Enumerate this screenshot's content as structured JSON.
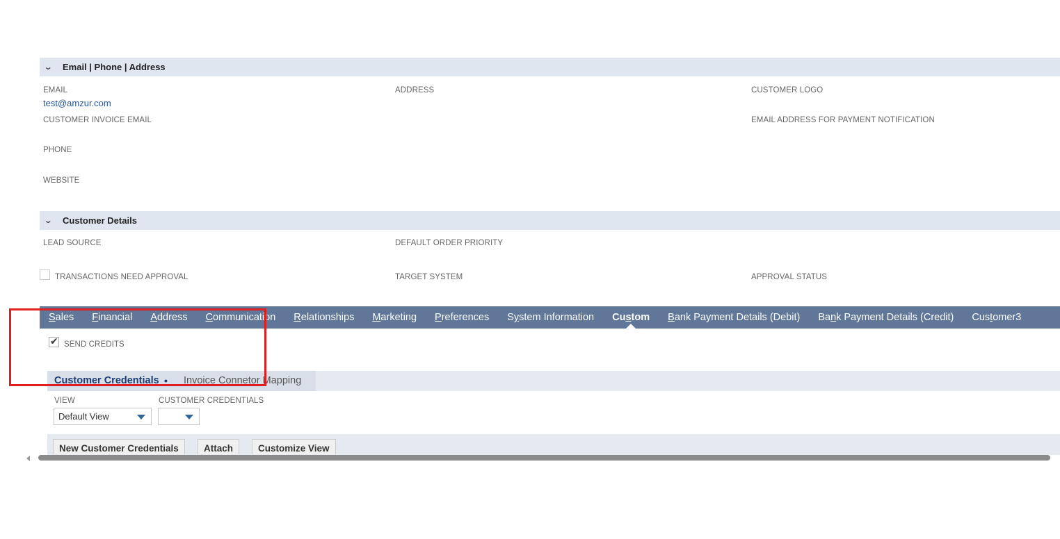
{
  "sections": {
    "contact": {
      "title": "Email | Phone | Address",
      "fields": {
        "email_label": "EMAIL",
        "email_value": "test@amzur.com",
        "address_label": "ADDRESS",
        "customer_logo_label": "CUSTOMER LOGO",
        "invoice_email_label": "CUSTOMER INVOICE EMAIL",
        "payment_notification_label": "EMAIL ADDRESS FOR PAYMENT NOTIFICATION",
        "phone_label": "PHONE",
        "website_label": "WEBSITE"
      }
    },
    "customer_details": {
      "title": "Customer Details",
      "fields": {
        "lead_source_label": "LEAD SOURCE",
        "default_order_priority_label": "DEFAULT ORDER PRIORITY",
        "transactions_need_approval_label": "TRANSACTIONS NEED APPROVAL",
        "target_system_label": "TARGET SYSTEM",
        "approval_status_label": "APPROVAL STATUS"
      }
    }
  },
  "tabs": [
    {
      "pre": "",
      "ul": "S",
      "post": "ales"
    },
    {
      "pre": "",
      "ul": "F",
      "post": "inancial"
    },
    {
      "pre": "",
      "ul": "A",
      "post": "ddress"
    },
    {
      "pre": "",
      "ul": "C",
      "post": "ommunication"
    },
    {
      "pre": "",
      "ul": "R",
      "post": "elationships"
    },
    {
      "pre": "",
      "ul": "M",
      "post": "arketing"
    },
    {
      "pre": "",
      "ul": "P",
      "post": "references"
    },
    {
      "pre": "S",
      "ul": "y",
      "post": "stem Information"
    },
    {
      "pre": "Cu",
      "ul": "s",
      "post": "tom"
    },
    {
      "pre": "",
      "ul": "B",
      "post": "ank Payment Details (Debit)"
    },
    {
      "pre": "Ba",
      "ul": "n",
      "post": "k Payment Details (Credit)"
    },
    {
      "pre": "Cus",
      "ul": "t",
      "post": "omer3"
    }
  ],
  "custom": {
    "send_credits_label": "SEND CREDITS",
    "send_credits_checked": true
  },
  "subtabs": {
    "active_label": "Customer Credentials",
    "active_dot": "•",
    "inactive_label": "Invoice Connetor Mapping"
  },
  "sublist": {
    "view_label": "VIEW",
    "view_value": "Default View",
    "credentials_label": "CUSTOMER CREDENTIALS",
    "credentials_value": "",
    "buttons": {
      "new": "New Customer Credentials",
      "attach": "Attach",
      "customize": "Customize View"
    }
  },
  "icons": {
    "section_toggle": "chevron-down-icon",
    "checkbox": "checkmark-icon",
    "dropdown": "caret-down-icon",
    "scroll_left": "arrow-left-icon"
  },
  "colors": {
    "tabbar": "#607799",
    "section_header": "#e0e6ef",
    "link": "#255599",
    "highlight": "#e02020"
  }
}
